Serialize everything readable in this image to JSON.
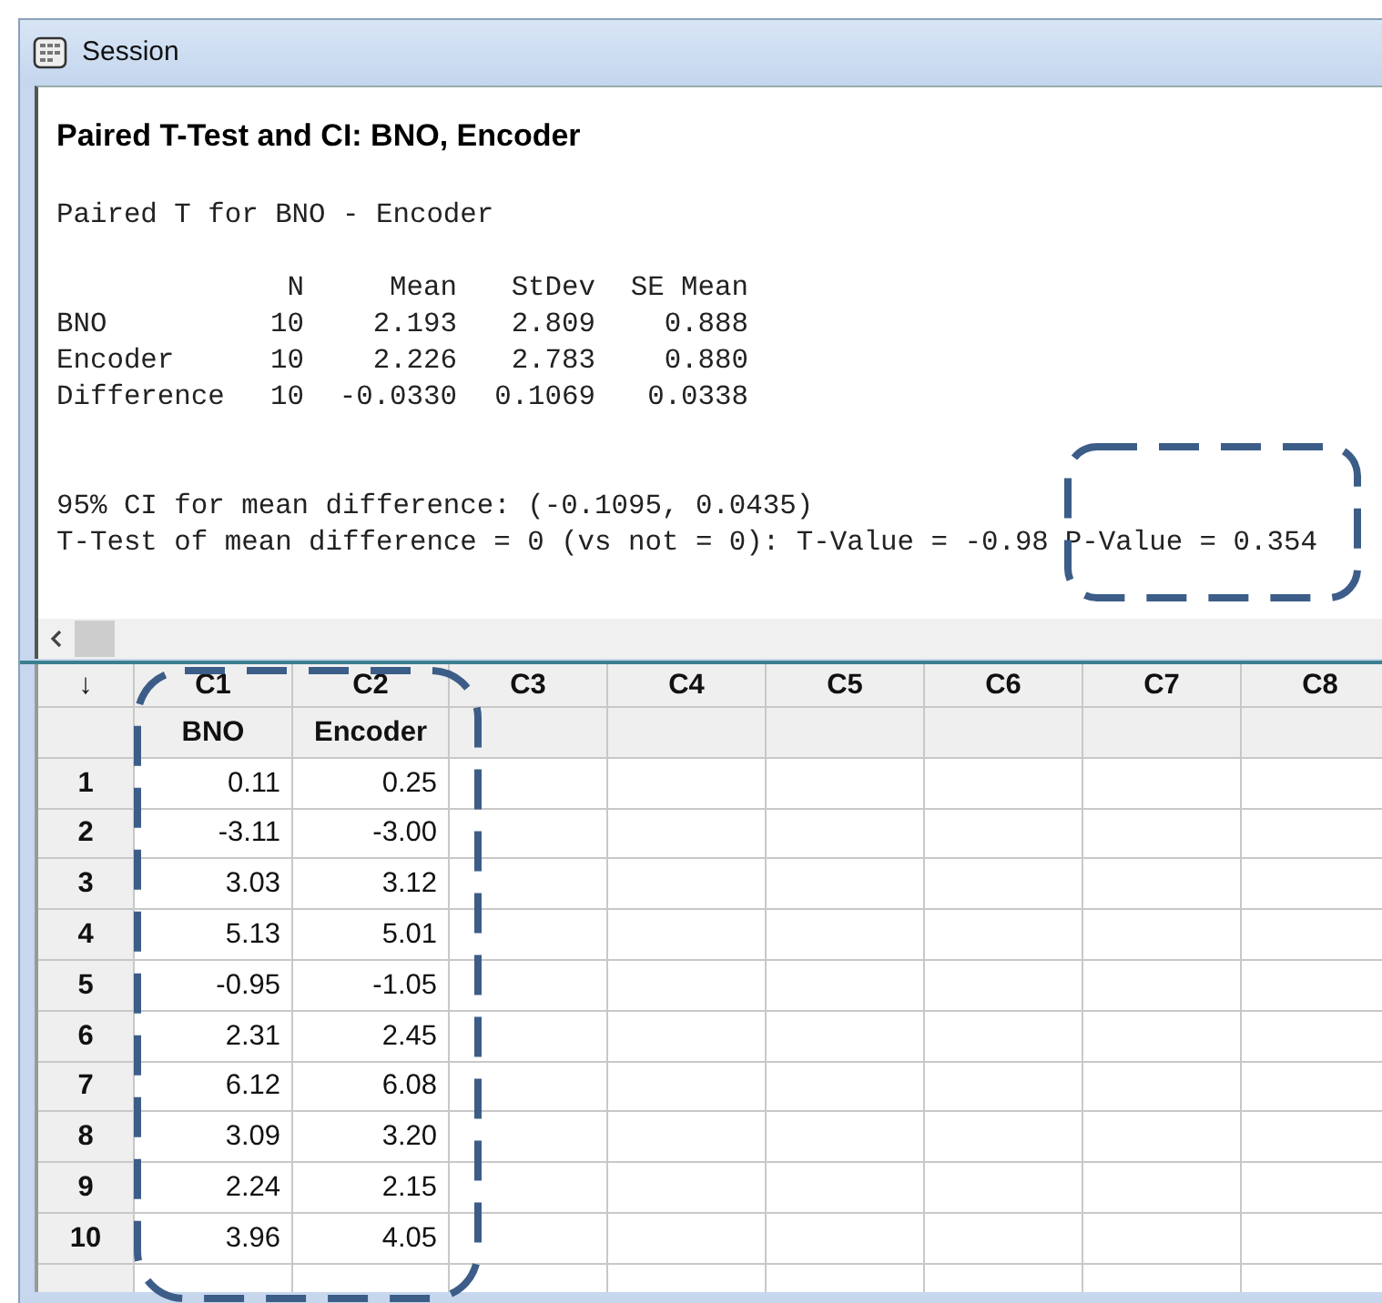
{
  "window": {
    "title": "Session"
  },
  "session": {
    "heading": "Paired T-Test and CI: BNO, Encoder",
    "subtitle": "Paired T for BNO - Encoder",
    "stats": {
      "columns": [
        "N",
        "Mean",
        "StDev",
        "SE Mean"
      ],
      "rows": [
        {
          "label": "BNO",
          "values": [
            "10",
            "2.193",
            "2.809",
            "0.888"
          ]
        },
        {
          "label": "Encoder",
          "values": [
            "10",
            "2.226",
            "2.783",
            "0.880"
          ]
        },
        {
          "label": "Difference",
          "values": [
            "10",
            "-0.0330",
            "0.1069",
            "0.0338"
          ]
        }
      ]
    },
    "ci_line": "95% CI for mean difference: (-0.1095, 0.0435)",
    "ttest_line": "T-Test of mean difference = 0 (vs not = 0): T-Value = -0.98",
    "p_value": "P-Value = 0.354"
  },
  "worksheet": {
    "corner": "↓",
    "columns": [
      {
        "id": "C1",
        "name": "BNO"
      },
      {
        "id": "C2",
        "name": "Encoder"
      },
      {
        "id": "C3"
      },
      {
        "id": "C4"
      },
      {
        "id": "C5"
      },
      {
        "id": "C6"
      },
      {
        "id": "C7"
      },
      {
        "id": "C8"
      }
    ],
    "rows": [
      {
        "label": "1",
        "values": [
          "0.11",
          "0.25"
        ]
      },
      {
        "label": "2",
        "values": [
          "-3.11",
          "-3.00"
        ]
      },
      {
        "label": "3",
        "values": [
          "3.03",
          "3.12"
        ]
      },
      {
        "label": "4",
        "values": [
          "5.13",
          "5.01"
        ]
      },
      {
        "label": "5",
        "values": [
          "-0.95",
          "-1.05"
        ]
      },
      {
        "label": "6",
        "values": [
          "2.31",
          "2.45"
        ]
      },
      {
        "label": "7",
        "values": [
          "6.12",
          "6.08"
        ]
      },
      {
        "label": "8",
        "values": [
          "3.09",
          "3.20"
        ]
      },
      {
        "label": "9",
        "values": [
          "2.24",
          "2.15"
        ]
      },
      {
        "label": "10",
        "values": [
          "3.96",
          "4.05"
        ]
      }
    ]
  }
}
